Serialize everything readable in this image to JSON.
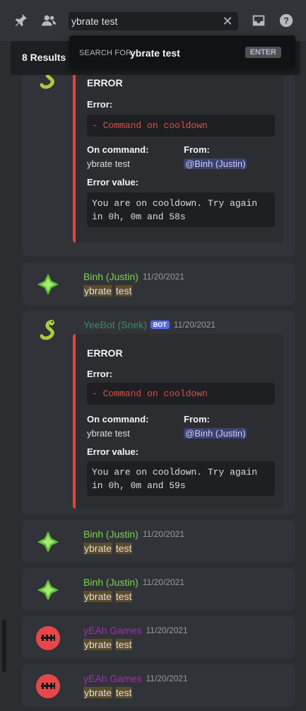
{
  "search": {
    "value": "ybrate test"
  },
  "results": {
    "count_label": "8 Results"
  },
  "dropdown": {
    "label": "SEARCH FOR:",
    "query": "ybrate test",
    "enter": "ENTER"
  },
  "embed_labels": {
    "title": "ERROR",
    "error": "Error:",
    "on_command": "On command:",
    "from": "From:",
    "error_value": "Error value:"
  },
  "messages": [
    {
      "author": "",
      "timestamp": "",
      "embed": {
        "error": "- Command on cooldown",
        "command": "ybrate test",
        "from": "@Binh (Justin)",
        "value_line1": "You are on cooldown. Try again",
        "value_line2": "in 0h, 0m and 58s"
      }
    },
    {
      "author": "Binh (Justin)",
      "timestamp": "11/20/2021",
      "w1": "ybrate",
      "w2": "test"
    },
    {
      "author": "YeeBot (Snek)",
      "tag": "BOT",
      "timestamp": "11/20/2021",
      "embed": {
        "error": "- Command on cooldown",
        "command": "ybrate test",
        "from": "@Binh (Justin)",
        "value_line1": "You are on cooldown. Try again",
        "value_line2": "in 0h, 0m and 59s"
      }
    },
    {
      "author": "Binh (Justin)",
      "timestamp": "11/20/2021",
      "w1": "ybrate",
      "w2": "test"
    },
    {
      "author": "Binh (Justin)",
      "timestamp": "11/20/2021",
      "w1": "ybrate",
      "w2": "test"
    },
    {
      "author": "yEAh Games",
      "timestamp": "11/20/2021",
      "w1": "ybrate",
      "w2": "test"
    },
    {
      "author": "yEAh Games",
      "timestamp": "11/20/2021",
      "w1": "ybrate",
      "w2": "test"
    }
  ],
  "icons": {
    "pin": "pin-icon",
    "members": "members-icon",
    "clear": "clear-search-icon",
    "inbox": "inbox-icon",
    "help": "help-icon",
    "snake": "snake-avatar",
    "binh": "green-sparkle-avatar",
    "yeah": "yeah-games-avatar"
  },
  "colors": {
    "binh": "#7cd34c",
    "bot_name": "#3d8a6a",
    "yeah": "#9b2fb5",
    "embed_bar": "#e0453b",
    "highlight": "#5b4c2a",
    "bot_tag": "#5865f2"
  }
}
